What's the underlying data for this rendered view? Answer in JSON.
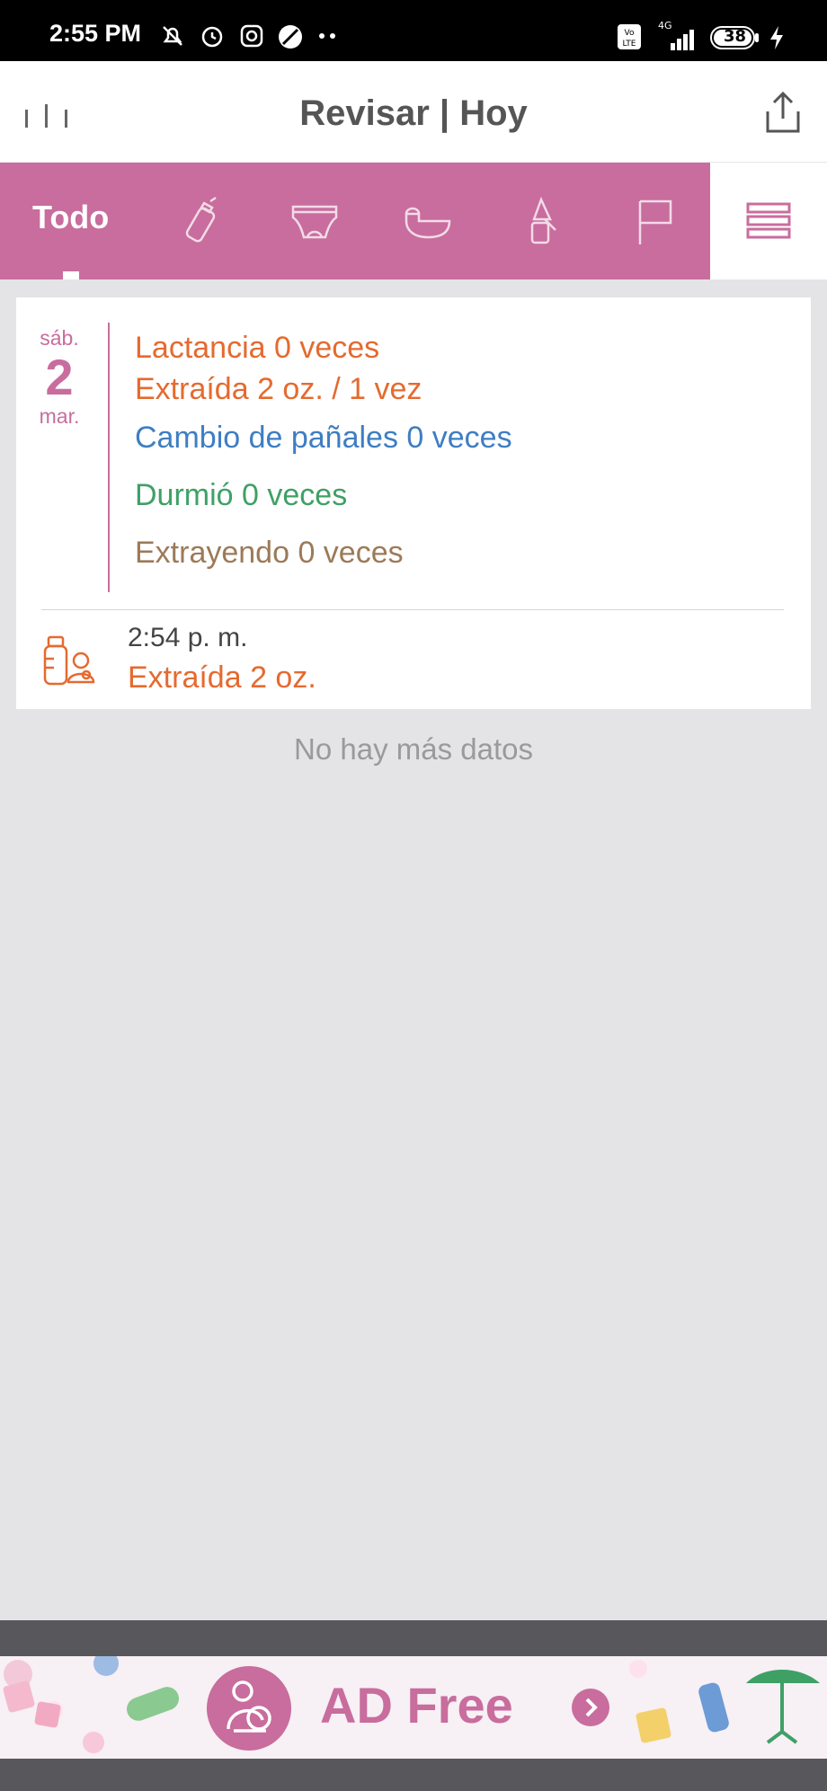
{
  "status_bar": {
    "time": "2:55 PM",
    "battery": "38",
    "network": "4G"
  },
  "header": {
    "title": "Revisar | Hoy",
    "menu_icon": "bars-icon",
    "share_icon": "share-icon"
  },
  "tabs": {
    "active_label": "Todo",
    "icons": [
      "bottle-icon",
      "diaper-icon",
      "sleep-icon",
      "pump-icon",
      "flag-icon"
    ],
    "accent": "#c86d9d"
  },
  "day_card": {
    "weekday": "sáb.",
    "day": "2",
    "month": "mar.",
    "summary": {
      "lactancia": "Lactancia  0 veces",
      "extraida": "Extraída 2 oz. / 1 vez",
      "panales": "Cambio de pañales 0 veces",
      "durmio": "Durmió  0 veces",
      "extrayendo": "Extrayendo 0 veces"
    },
    "entry": {
      "time": "2:54 p. m.",
      "text": "Extraída 2 oz."
    }
  },
  "footer_text": "No hay más datos",
  "ad": {
    "label": "AD Free"
  }
}
